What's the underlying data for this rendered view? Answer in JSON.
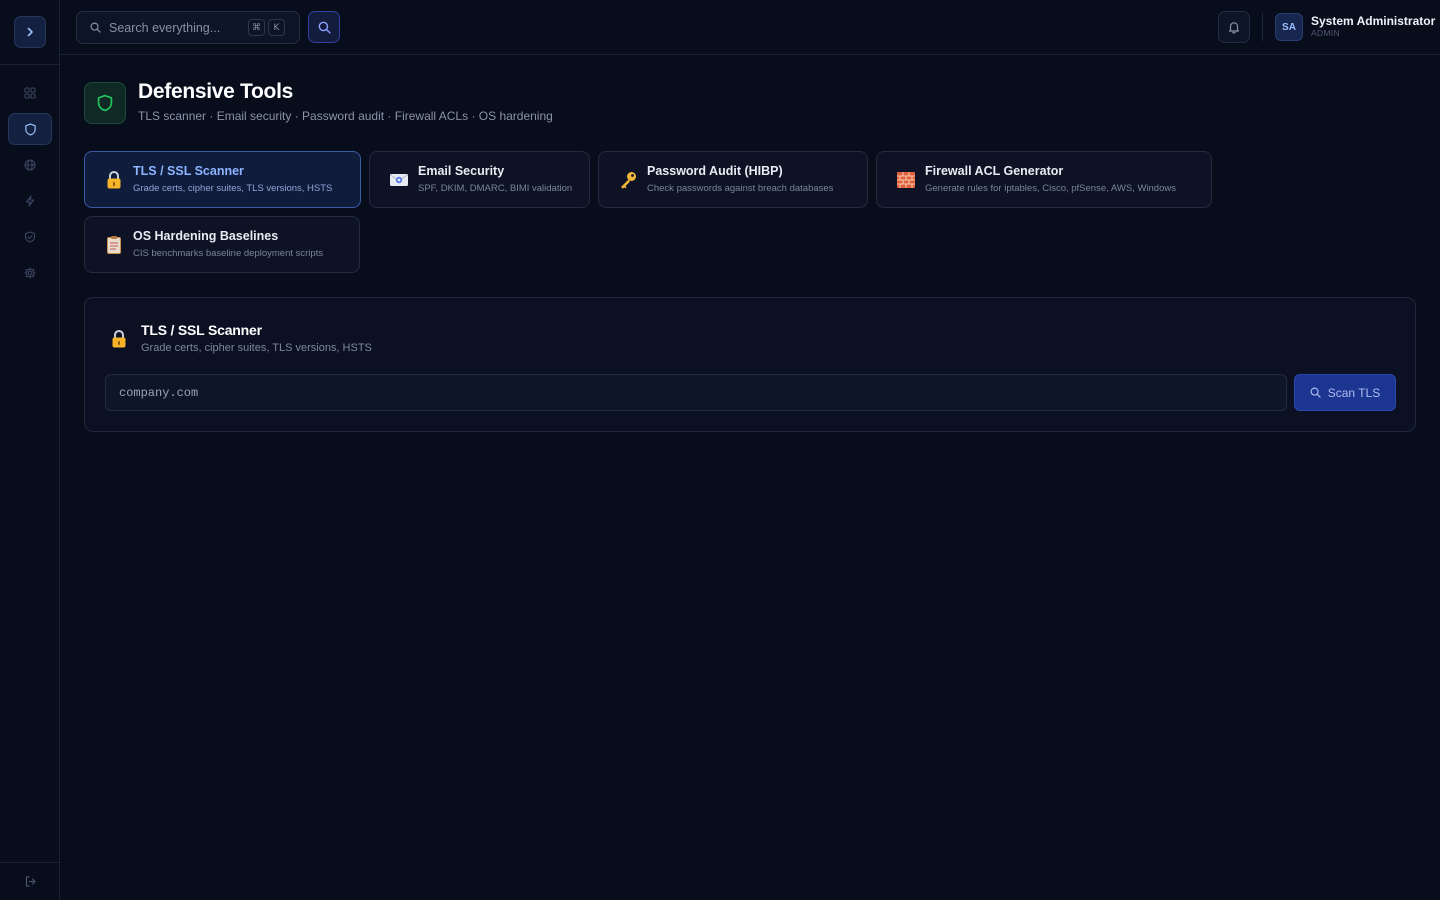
{
  "header": {
    "search_placeholder": "Search everything...",
    "shortcut_keys": [
      "⌘",
      "K"
    ],
    "user": {
      "initials": "SA",
      "name": "System Administrator",
      "role": "ADMIN"
    }
  },
  "page": {
    "title": "Defensive Tools",
    "subtitle": "TLS scanner · Email security · Password audit · Firewall ACLs · OS hardening"
  },
  "tools": [
    {
      "title": "TLS / SSL Scanner",
      "desc": "Grade certs, cipher suites, TLS versions, HSTS",
      "icon": "lock-icon",
      "active": true
    },
    {
      "title": "Email Security",
      "desc": "SPF, DKIM, DMARC, BIMI validation",
      "icon": "envelope-icon",
      "active": false
    },
    {
      "title": "Password Audit (HIBP)",
      "desc": "Check passwords against breach databases",
      "icon": "key-icon",
      "active": false
    },
    {
      "title": "Firewall ACL Generator",
      "desc": "Generate rules for iptables, Cisco, pfSense, AWS, Windows",
      "icon": "brick-wall-icon",
      "active": false
    },
    {
      "title": "OS Hardening Baselines",
      "desc": "CIS benchmarks baseline deployment scripts",
      "icon": "clipboard-icon",
      "active": false
    }
  ],
  "scanner": {
    "title": "TLS / SSL Scanner",
    "subtitle": "Grade certs, cipher suites, TLS versions, HSTS",
    "input_placeholder": "company.com",
    "button_label": "Scan TLS"
  },
  "colors": {
    "accent": "#3a5ba8",
    "button": "#1c3590",
    "background": "#080d1c",
    "shield": "#22c55e"
  }
}
